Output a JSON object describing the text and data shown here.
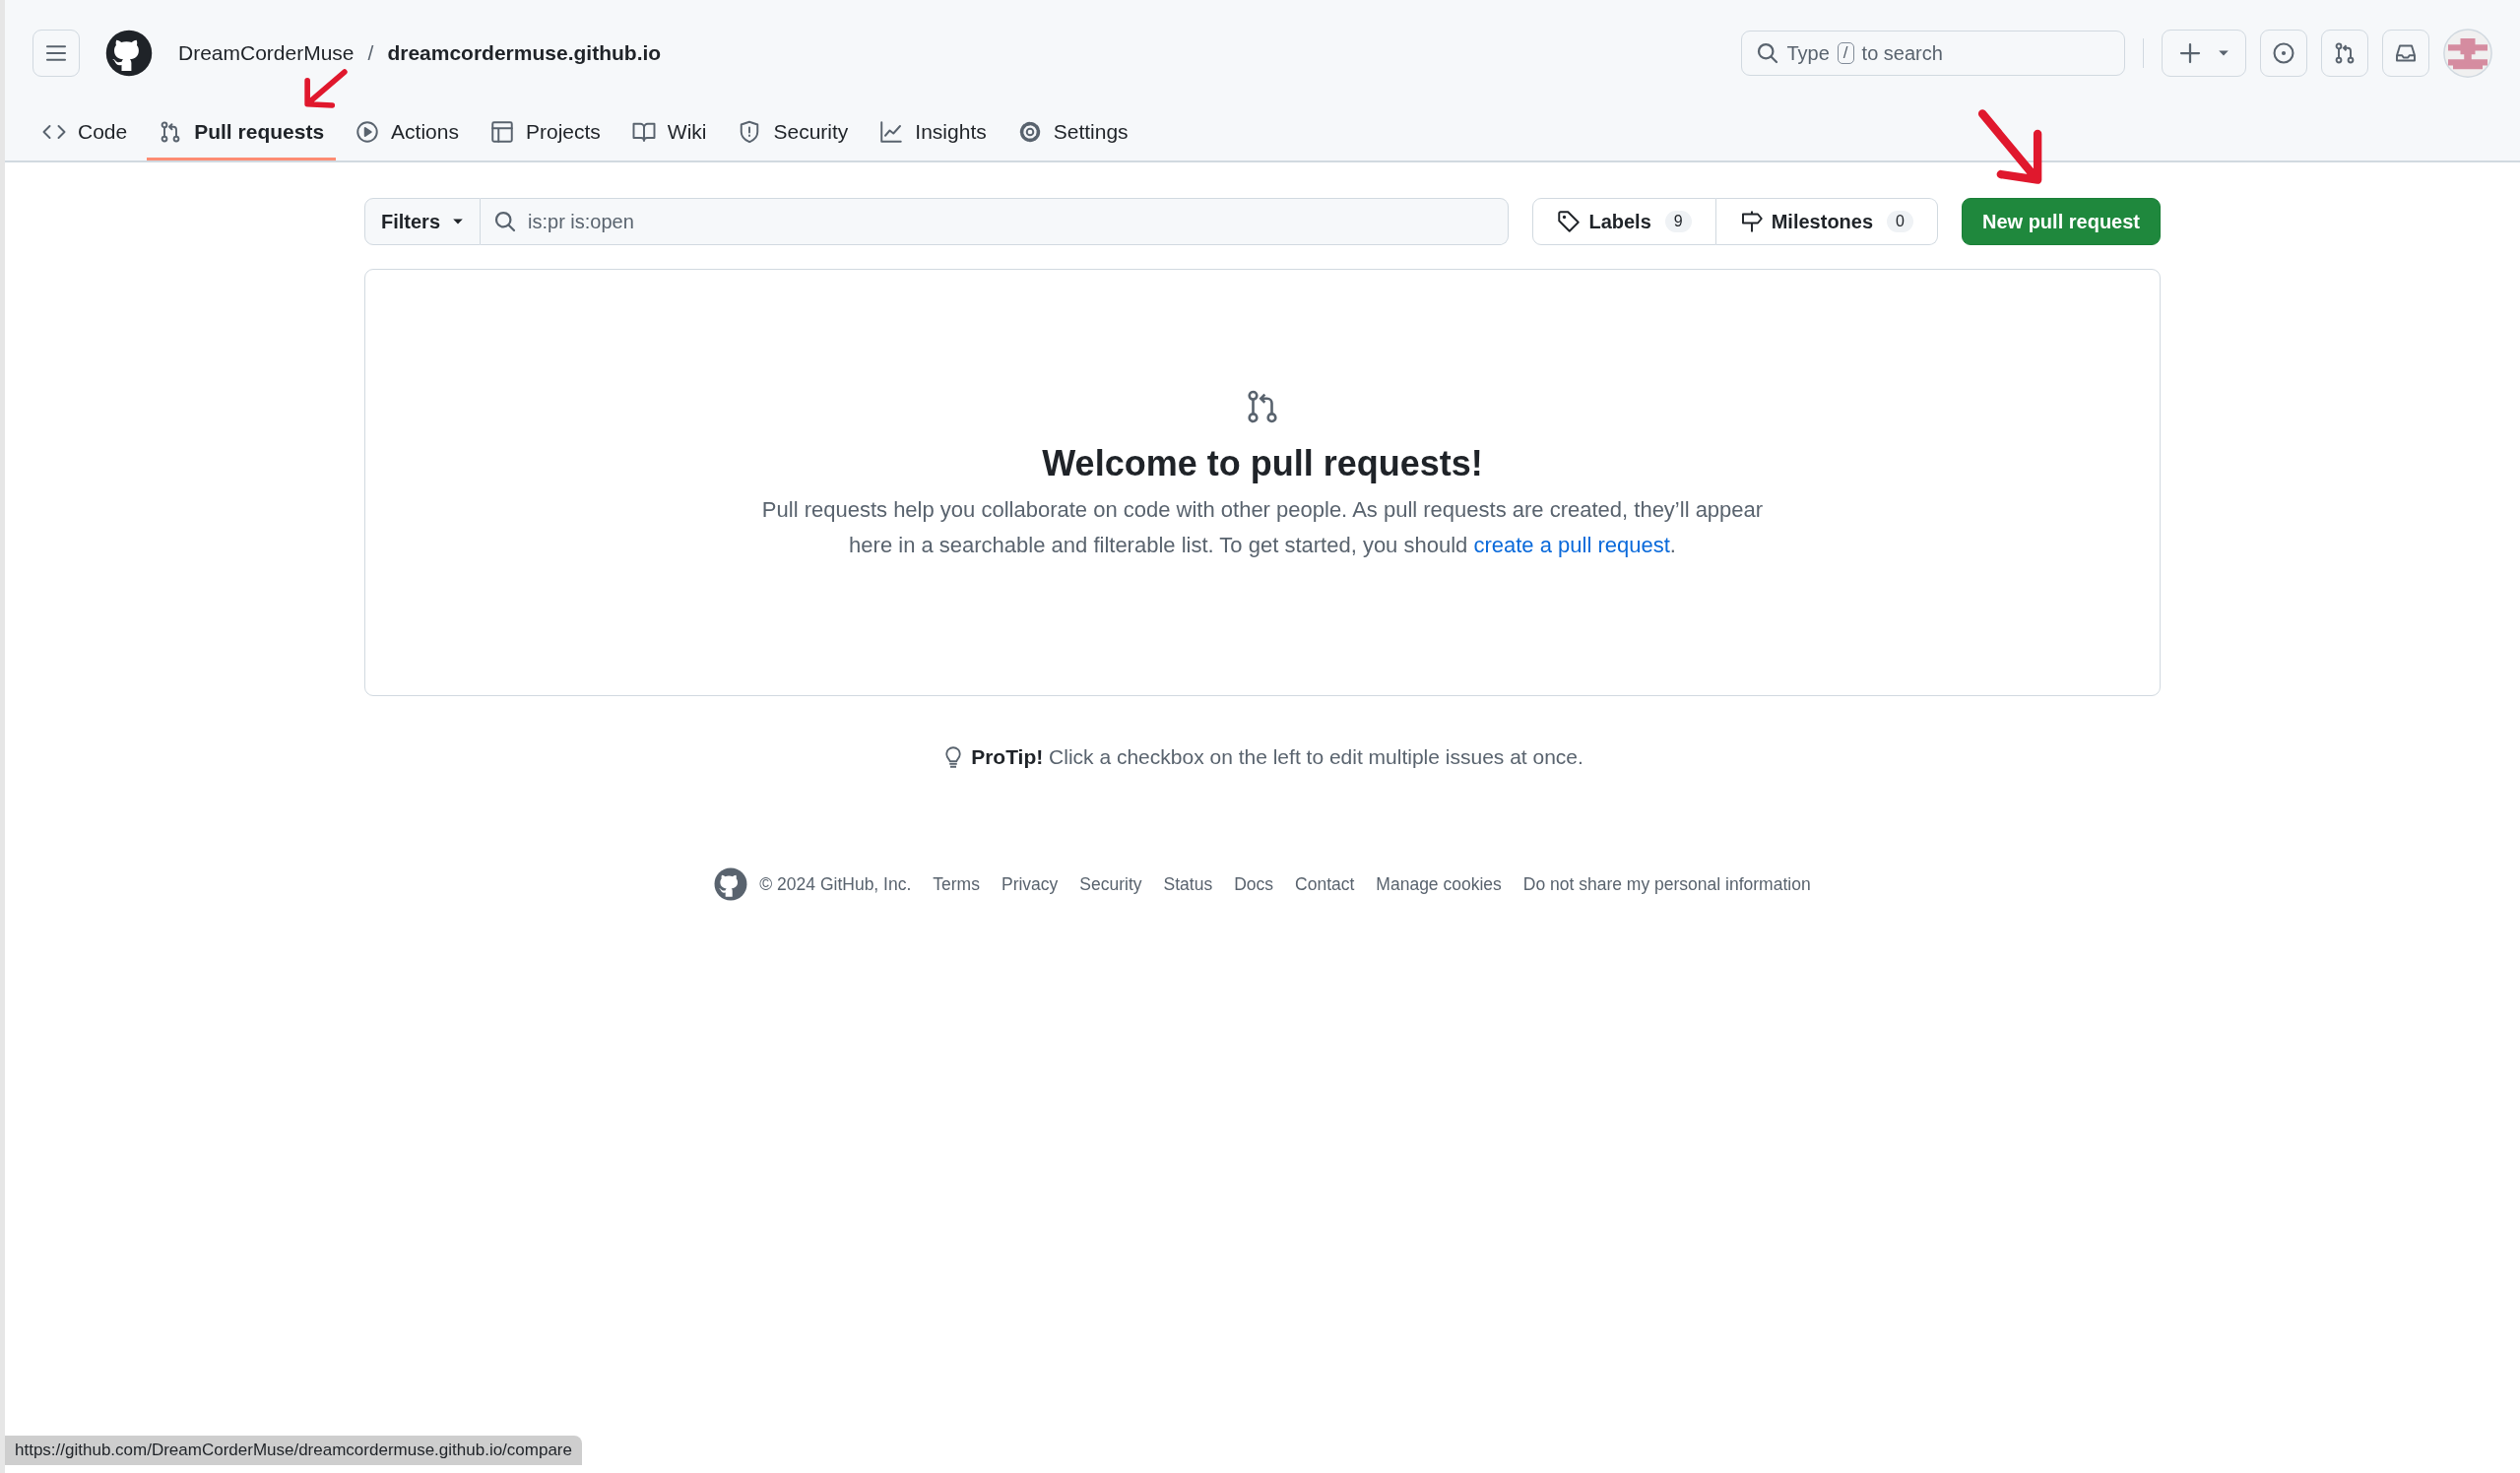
{
  "header": {
    "breadcrumb": {
      "owner": "DreamCorderMuse",
      "separator": "/",
      "repo": "dreamcordermuse.github.io"
    },
    "search": {
      "before_key": "Type",
      "key": "/",
      "after_key": "to search"
    }
  },
  "tabs": [
    {
      "label": "Code",
      "selected": false
    },
    {
      "label": "Pull requests",
      "selected": true
    },
    {
      "label": "Actions",
      "selected": false
    },
    {
      "label": "Projects",
      "selected": false
    },
    {
      "label": "Wiki",
      "selected": false
    },
    {
      "label": "Security",
      "selected": false
    },
    {
      "label": "Insights",
      "selected": false
    },
    {
      "label": "Settings",
      "selected": false
    }
  ],
  "toolbar": {
    "filters_button": "Filters",
    "search_value": "is:pr is:open",
    "labels": {
      "label": "Labels",
      "count": "9"
    },
    "milestones": {
      "label": "Milestones",
      "count": "0"
    },
    "new_button": "New pull request"
  },
  "blankslate": {
    "title": "Welcome to pull requests!",
    "text": "Pull requests help you collaborate on code with other people. As pull requests are created, they’ll appear here in a searchable and filterable list. To get started, you should",
    "link": "create a pull request",
    "after_link": "."
  },
  "protip": {
    "lead": "ProTip!",
    "text": "Click a checkbox on the left to edit multiple issues at once."
  },
  "footer": {
    "copyright": "© 2024 GitHub, Inc.",
    "links": [
      "Terms",
      "Privacy",
      "Security",
      "Status",
      "Docs",
      "Contact",
      "Manage cookies",
      "Do not share my personal information"
    ]
  },
  "status_bar": {
    "url": "https://github.com/DreamCorderMuse/dreamcordermuse.github.io/compare"
  }
}
